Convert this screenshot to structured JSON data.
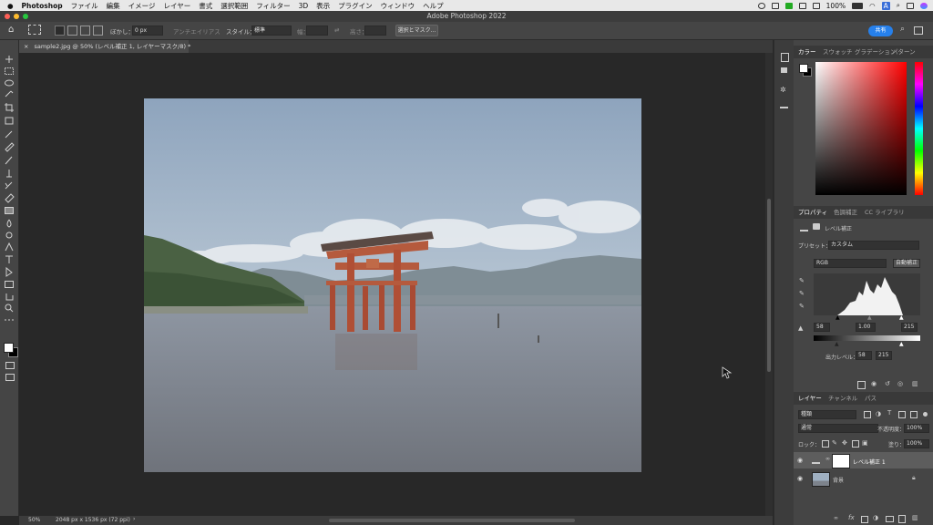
{
  "menubar": {
    "app": "Photoshop",
    "items": [
      "ファイル",
      "編集",
      "イメージ",
      "レイヤー",
      "書式",
      "選択範囲",
      "フィルター",
      "3D",
      "表示",
      "プラグイン",
      "ウィンドウ",
      "ヘルプ"
    ],
    "battery": "100%",
    "input_indicator": "A"
  },
  "window": {
    "title": "Adobe Photoshop 2022"
  },
  "options": {
    "feather_label": "ぼかし：",
    "feather_value": "0 px",
    "antialias_label": "アンチエイリアス",
    "style_label": "スタイル：",
    "style_value": "標準",
    "width_label": "幅：",
    "height_label": "高さ：",
    "select_mask_button": "選択とマスク...",
    "share_button": "共有"
  },
  "document": {
    "tab_title": "sample2.jpg @ 50% (レベル補正 1, レイヤーマスク/8) *",
    "close": "×"
  },
  "status": {
    "zoom": "50%",
    "doc_info": "2048 px x 1536 px (72 ppi)",
    "arrow": "›"
  },
  "color_panel": {
    "tabs": [
      "カラー",
      "スウォッチ",
      "グラデーション",
      "パターン"
    ],
    "foreground": "#ffffff",
    "background": "#000000"
  },
  "properties_panel": {
    "tabs": [
      "プロパティ",
      "色調補正",
      "CC ライブラリ"
    ],
    "type_label": "レベル補正",
    "preset_label": "プリセット：",
    "preset_value": "カスタム",
    "channel_value": "RGB",
    "auto_button": "自動補正",
    "input_black": "58",
    "input_gamma": "1.00",
    "input_white": "215",
    "output_label": "出力レベル：",
    "output_black": "58",
    "output_white": "215"
  },
  "layers_panel": {
    "tabs": [
      "レイヤー",
      "チャンネル",
      "パス"
    ],
    "kind_filter": "種類",
    "blend_mode": "通常",
    "opacity_label": "不透明度：",
    "opacity_value": "100%",
    "lock_label": "ロック：",
    "fill_label": "塗り：",
    "fill_value": "100%",
    "layers": [
      {
        "name": "レベル補正 1",
        "selected": true
      },
      {
        "name": "背景",
        "selected": false
      }
    ]
  },
  "colors": {
    "accent": "#2680eb",
    "panel": "#454545",
    "canvas_bg": "#282828"
  }
}
